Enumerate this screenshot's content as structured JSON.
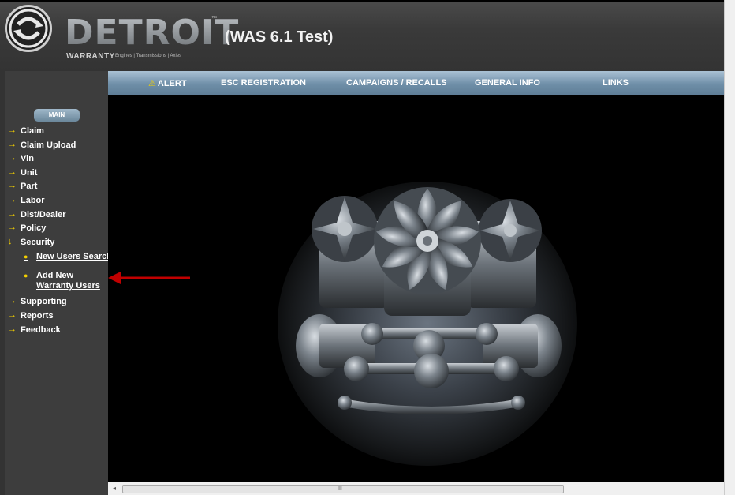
{
  "header": {
    "brand": "DETROIT",
    "trademark": "™",
    "sub_brand": "WARRANTY",
    "tagline": "Engines | Transmissions | Axles",
    "title": "(WAS 6.1 Test)"
  },
  "nav": {
    "alert": "ALERT",
    "esc_registration": "ESC REGISTRATION",
    "campaigns": "CAMPAIGNS / RECALLS",
    "general_info": "GENERAL INFO",
    "links": "LINKS"
  },
  "sidebar": {
    "main_button": "MAIN",
    "items": [
      {
        "label": "Claim"
      },
      {
        "label": "Claim Upload"
      },
      {
        "label": "Vin"
      },
      {
        "label": "Unit"
      },
      {
        "label": "Part"
      },
      {
        "label": "Labor"
      },
      {
        "label": "Dist/Dealer"
      },
      {
        "label": "Policy"
      },
      {
        "label": "Security"
      }
    ],
    "security_sub": [
      {
        "label": "New Users Search"
      },
      {
        "label": "Add New Warranty Users"
      }
    ],
    "items_after": [
      {
        "label": "Supporting"
      },
      {
        "label": "Reports"
      },
      {
        "label": "Feedback"
      }
    ]
  },
  "scrollbar": {
    "grip": "III"
  },
  "colors": {
    "arrow": "#f4d000",
    "annotation": "#c00000",
    "nav_bar": "#7f9cb4"
  }
}
